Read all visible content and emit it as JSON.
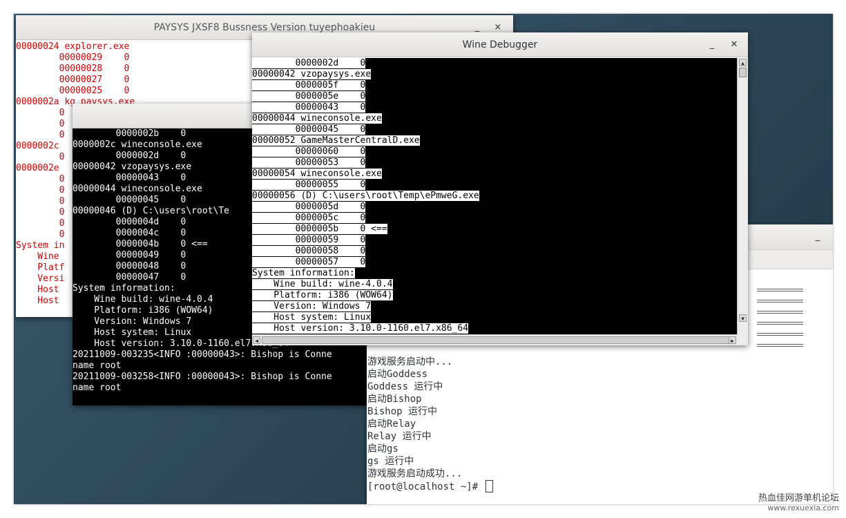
{
  "paysys_window": {
    "title": "PAYSYS JXSF8 Bussness Version tuyephoakieu",
    "min_btn": "_",
    "close_btn": "×",
    "lines": [
      "00000024 explorer.exe",
      "        00000029    0",
      "        00000028    0",
      "        00000027    0",
      "        00000025    0",
      "0000002a kg_paysys.exe",
      "        0",
      "        0",
      "        0",
      "0000002c",
      "        0",
      "0000002e",
      "        0",
      "        0",
      "        0",
      "        0",
      "        0",
      "        0",
      "System in",
      "    Wine",
      "    Platf",
      "    Versi",
      "    Host",
      "    Host"
    ]
  },
  "console_window": {
    "lines": [
      "        0000002b    0",
      "0000002c wineconsole.exe",
      "        0000002d    0",
      "00000042 vzopaysys.exe",
      "        00000043    0",
      "00000044 wineconsole.exe",
      "        00000045    0",
      "00000046 (D) C:\\users\\root\\Te",
      "        0000004d    0",
      "        0000004c    0",
      "        0000004b    0 <==",
      "        00000049    0",
      "        00000048    0",
      "        00000047    0",
      "System information:",
      "    Wine build: wine-4.0.4",
      "    Platform: i386 (WOW64)",
      "    Version: Windows 7",
      "    Host system: Linux",
      "    Host version: 3.10.0-1160.el7.x86_64",
      "20211009-003235<INFO :00000043>: Bishop is Conne",
      "name root",
      "20211009-003258<INFO :00000043>: Bishop is Conne",
      "name root"
    ]
  },
  "terminal_window": {
    "min_btn": "_",
    "lines": [
      "游戏服务启动中...",
      "启动Goddess",
      "Goddess 运行中",
      "启动Bishop",
      "Bishop 运行中",
      "启动Relay",
      "Relay 运行中",
      "启动gs",
      "gs 运行中",
      "游戏服务启动成功..."
    ],
    "prompt": "[root@localhost ~]# "
  },
  "debugger_window": {
    "title": "Wine Debugger",
    "min_btn": "_",
    "close_btn": "✕",
    "lines": [
      "        0000002d    0",
      "00000042 vzopaysys.exe",
      "        0000005f    0",
      "        0000005e    0",
      "        00000043    0",
      "00000044 wineconsole.exe",
      "        00000045    0",
      "00000052 GameMasterCentralD.exe",
      "        00000060    0",
      "        00000053    0",
      "00000054 wineconsole.exe",
      "        00000055    0",
      "00000056 (D) C:\\users\\root\\Temp\\ePmweG.exe",
      "        0000005d    0",
      "        0000005c    0",
      "        0000005b    0 <==",
      "        00000059    0",
      "        00000058    0",
      "        00000057    0",
      "System information:",
      "    Wine build: wine-4.0.4",
      "    Platform: i386 (WOW64)",
      "    Version: Windows 7",
      "    Host system: Linux",
      "    Host version: 3.10.0-1160.el7.x86_64"
    ]
  },
  "watermark": {
    "line1": "热血佳网游单机论坛",
    "line2": "www.rexuexia.com"
  }
}
